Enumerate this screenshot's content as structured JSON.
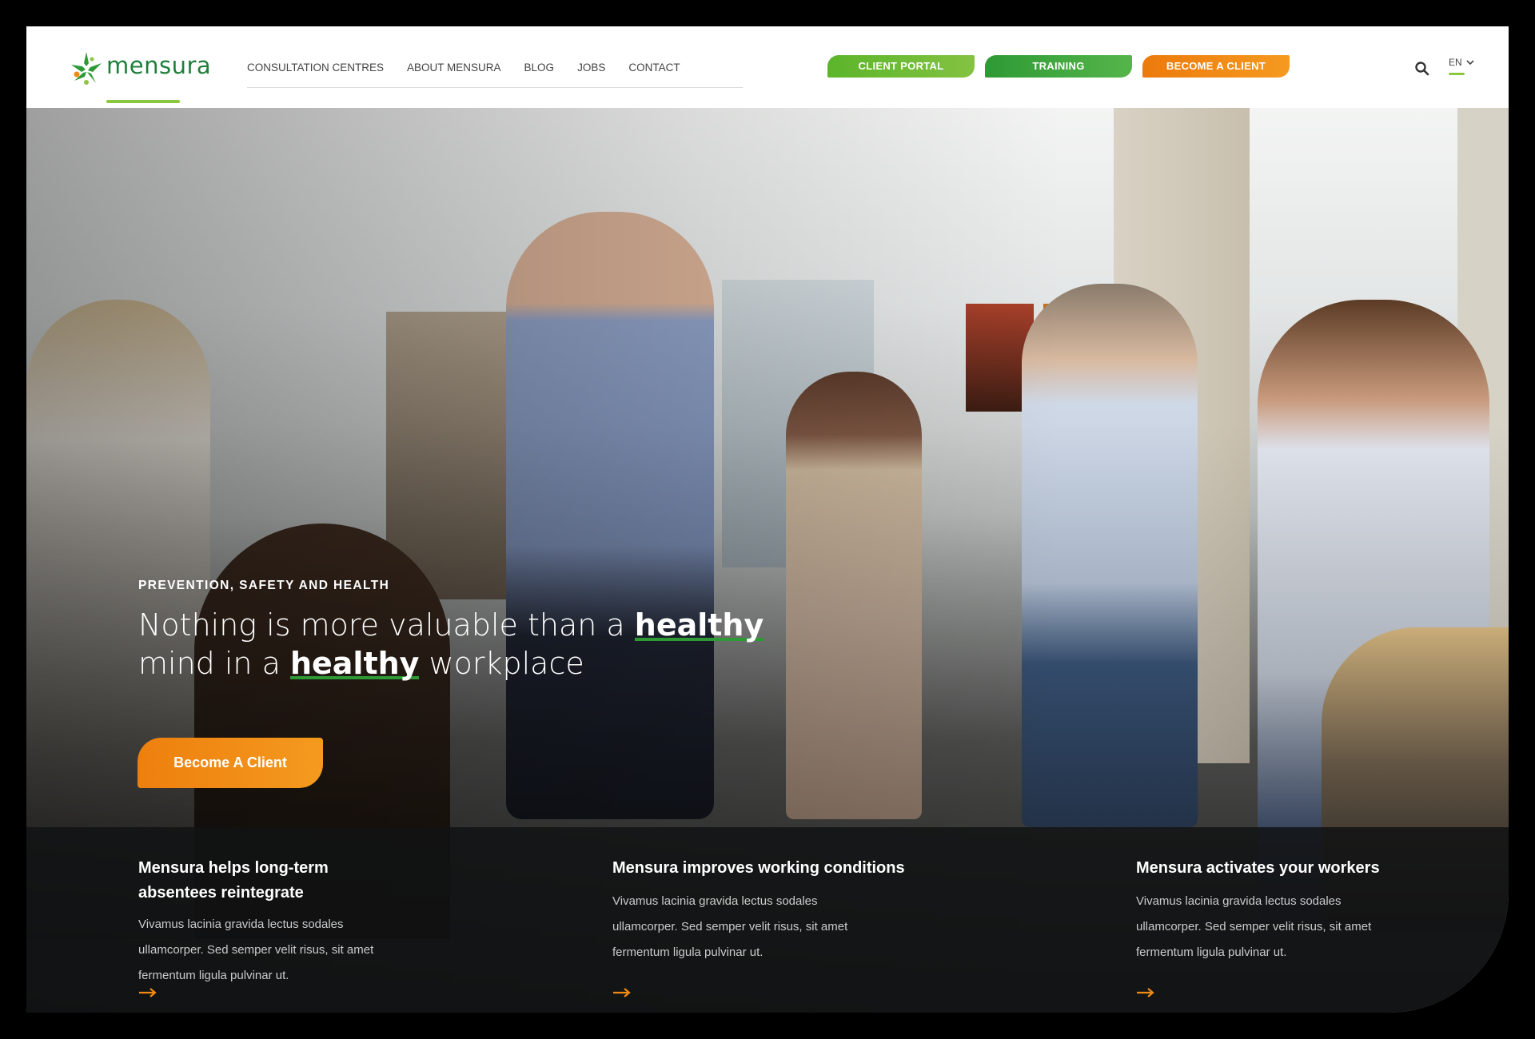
{
  "brand": {
    "logo_text": "mensura",
    "green": "#2e9a35",
    "light_green": "#8cc63f",
    "orange": "#f18a12"
  },
  "nav": {
    "items": [
      "CONSULTATION CENTRES",
      "ABOUT MENSURA",
      "BLOG",
      "JOBS",
      "CONTACT"
    ]
  },
  "header_buttons": {
    "client_portal": "CLIENT PORTAL",
    "training": "TRAINING",
    "become_client": "BECOME A CLIENT"
  },
  "language": "EN",
  "hero": {
    "eyebrow": "PREVENTION, SAFETY AND HEALTH",
    "line1_prefix": "Nothing is more valuable than a ",
    "line1_bold": "healthy",
    "line2_prefix": "mind in a ",
    "line2_bold": "healthy",
    "line2_suffix": " workplace",
    "cta": "Become A Client"
  },
  "features": [
    {
      "title": "Mensura helps long-term absentees reintegrate",
      "body": "Vivamus lacinia gravida lectus sodales ullamcorper. Sed semper velit risus, sit amet fermentum ligula pulvinar ut."
    },
    {
      "title": "Mensura improves working conditions",
      "body": "Vivamus lacinia gravida lectus sodales ullamcorper. Sed semper velit risus, sit amet fermentum ligula pulvinar ut."
    },
    {
      "title": "Mensura activates your workers",
      "body": "Vivamus lacinia gravida lectus sodales ullamcorper. Sed semper velit risus, sit amet fermentum ligula pulvinar ut."
    }
  ]
}
